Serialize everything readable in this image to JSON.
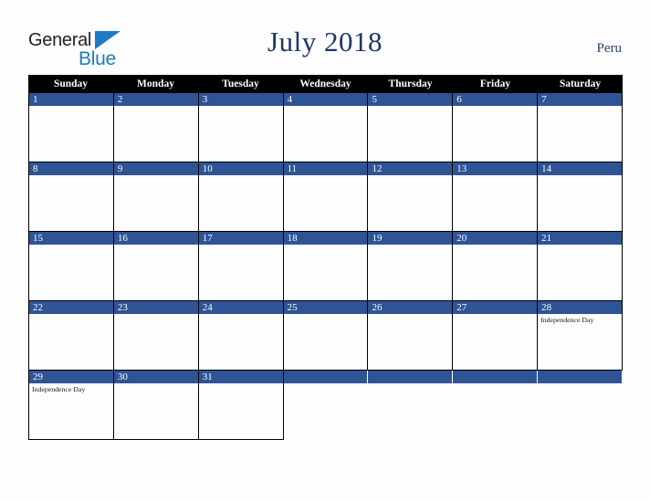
{
  "brand": {
    "name_part1": "General",
    "name_part2": "Blue",
    "triangle_color": "#1f7ac4",
    "text_color": "#231f20"
  },
  "header": {
    "title": "July 2018",
    "country": "Peru",
    "title_color": "#1f3864"
  },
  "calendar": {
    "accent_color": "#2e5496",
    "header_bg": "#000000",
    "weekdays": [
      "Sunday",
      "Monday",
      "Tuesday",
      "Wednesday",
      "Thursday",
      "Friday",
      "Saturday"
    ],
    "weeks": [
      [
        {
          "date": "1",
          "events": []
        },
        {
          "date": "2",
          "events": []
        },
        {
          "date": "3",
          "events": []
        },
        {
          "date": "4",
          "events": []
        },
        {
          "date": "5",
          "events": []
        },
        {
          "date": "6",
          "events": []
        },
        {
          "date": "7",
          "events": []
        }
      ],
      [
        {
          "date": "8",
          "events": []
        },
        {
          "date": "9",
          "events": []
        },
        {
          "date": "10",
          "events": []
        },
        {
          "date": "11",
          "events": []
        },
        {
          "date": "12",
          "events": []
        },
        {
          "date": "13",
          "events": []
        },
        {
          "date": "14",
          "events": []
        }
      ],
      [
        {
          "date": "15",
          "events": []
        },
        {
          "date": "16",
          "events": []
        },
        {
          "date": "17",
          "events": []
        },
        {
          "date": "18",
          "events": []
        },
        {
          "date": "19",
          "events": []
        },
        {
          "date": "20",
          "events": []
        },
        {
          "date": "21",
          "events": []
        }
      ],
      [
        {
          "date": "22",
          "events": []
        },
        {
          "date": "23",
          "events": []
        },
        {
          "date": "24",
          "events": []
        },
        {
          "date": "25",
          "events": []
        },
        {
          "date": "26",
          "events": []
        },
        {
          "date": "27",
          "events": []
        },
        {
          "date": "28",
          "events": [
            "Independence Day"
          ]
        }
      ],
      [
        {
          "date": "29",
          "events": [
            "Independence Day"
          ]
        },
        {
          "date": "30",
          "events": []
        },
        {
          "date": "31",
          "events": []
        },
        {
          "date": "",
          "events": []
        },
        {
          "date": "",
          "events": []
        },
        {
          "date": "",
          "events": []
        },
        {
          "date": "",
          "events": []
        }
      ]
    ]
  }
}
